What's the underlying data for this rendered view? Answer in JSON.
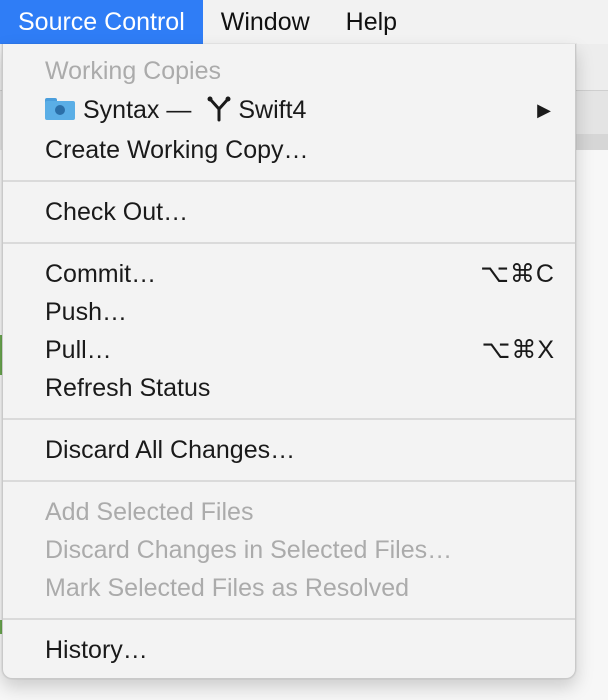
{
  "menubar": {
    "items": [
      "Source Control",
      "Window",
      "Help"
    ]
  },
  "menu": {
    "working_copies_header": "Working Copies",
    "repo_item": {
      "icon": "folder-clock-icon",
      "repo": "Syntax",
      "dash": "—",
      "branch_icon": "branch-icon",
      "branch": "Swift4",
      "arrow": "▶"
    },
    "create_working_copy": "Create Working Copy…",
    "check_out": "Check Out…",
    "commit": {
      "label": "Commit…",
      "shortcut": "⌥⌘C"
    },
    "push": "Push…",
    "pull": {
      "label": "Pull…",
      "shortcut": "⌥⌘X"
    },
    "refresh_status": "Refresh Status",
    "discard_all": "Discard All Changes…",
    "add_selected": "Add Selected Files",
    "discard_selected": "Discard Changes in Selected Files…",
    "mark_resolved": "Mark Selected Files as Resolved",
    "history": "History…"
  },
  "colors": {
    "highlight": "#2f7df6",
    "disabled_text": "#ababab"
  }
}
